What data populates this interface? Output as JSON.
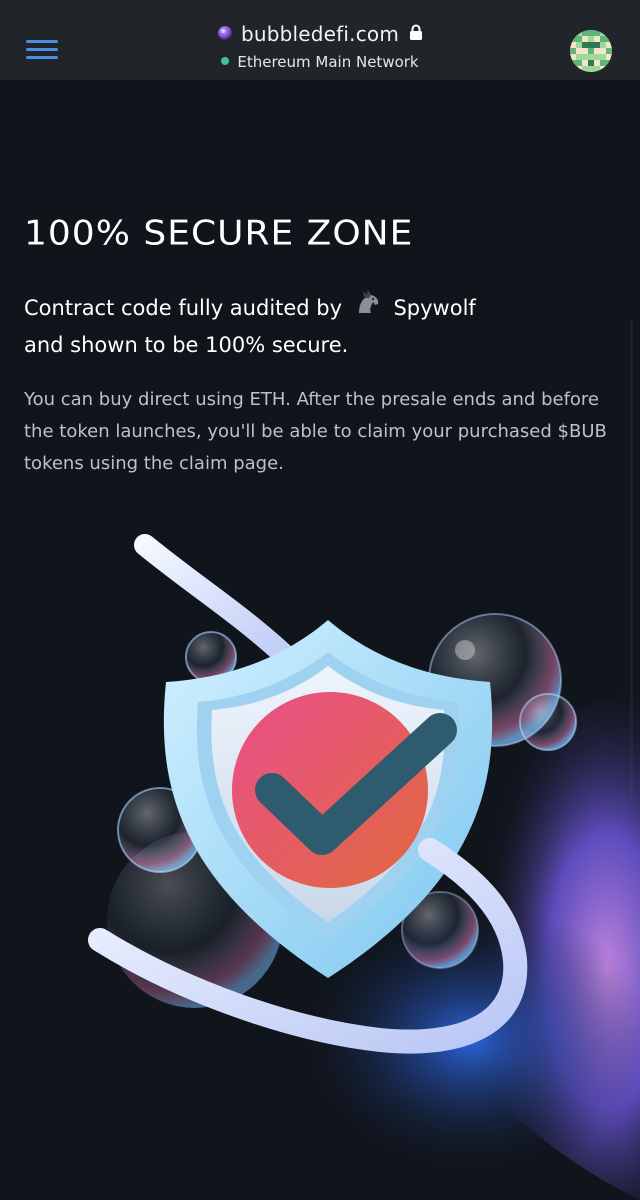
{
  "browser": {
    "url": "bubbledefi.com",
    "network": "Ethereum Main Network",
    "network_status_color": "#3ec28f",
    "menu_icon": "hamburger-icon",
    "lock_icon": "lock-icon",
    "accent": "#4a90e2"
  },
  "section": {
    "title": "100% SECURE ZONE",
    "lead_line1_prefix": "Contract code fully audited by",
    "auditor_icon": "horse-icon",
    "auditor_name": "Spywolf",
    "lead_line2": "and shown to be 100% secure.",
    "body": "You can buy direct using ETH. After the presale ends and before the token launches, you'll be able to claim your purchased $BUB tokens using the claim page."
  },
  "illustration": {
    "icons": [
      "shield-check-icon",
      "bubble-icon"
    ]
  }
}
